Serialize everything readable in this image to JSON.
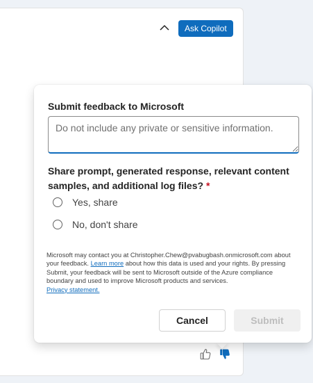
{
  "header": {
    "ask_copilot_label": "Ask Copilot",
    "collapse_icon": "chevron-up-icon"
  },
  "feedback_footer": {
    "like_icon": "thumbs-up-icon",
    "dislike_icon": "thumbs-down-filled-icon"
  },
  "feedback_form": {
    "title": "Submit feedback to Microsoft",
    "textarea_value": "",
    "textarea_placeholder": "Do not include any private or sensitive information.",
    "share_question": "Share prompt, generated response, relevant content samples, and additional log files?",
    "required_marker": "*",
    "options": [
      {
        "label": "Yes, share",
        "selected": false
      },
      {
        "label": "No, don't share",
        "selected": false
      }
    ],
    "disclaimer": {
      "part1": "Microsoft may contact you at Christopher.Chew@pvabugbash.onmicrosoft.com about your feedback. ",
      "learn_more": "Learn more",
      "part2": " about how this data is used and your rights. By pressing Submit, your feedback will be sent to Microsoft outside of the Azure compliance boundary and used to improve Microsoft products and services.",
      "privacy_link": "Privacy statement."
    },
    "cancel_label": "Cancel",
    "submit_label": "Submit"
  },
  "colors": {
    "accent": "#0f6cbd",
    "required": "#c50f1f",
    "disabled_bg": "#f0f0f0",
    "disabled_text": "#bdbdbd"
  }
}
